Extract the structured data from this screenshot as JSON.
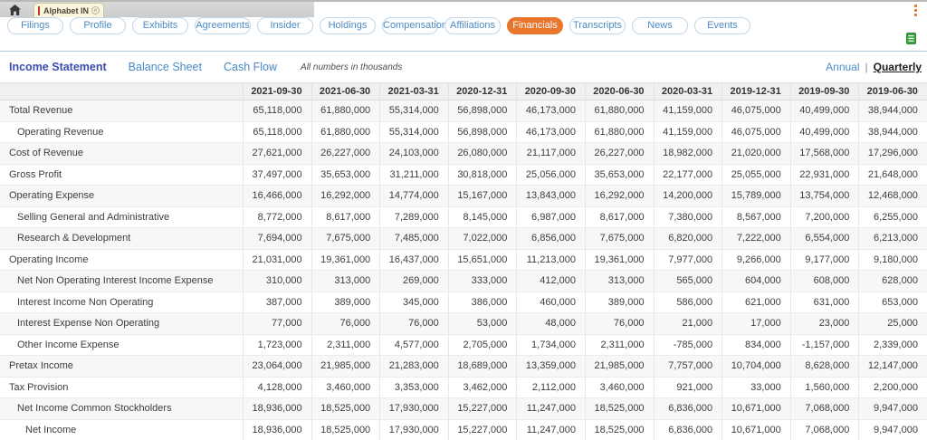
{
  "window": {
    "tab_title": "Alphabet INC",
    "tab_close_glyph": "×"
  },
  "icons": {
    "home": "home-icon",
    "tab_close": "close-icon",
    "menu": "kebab-menu-icon",
    "export": "spreadsheet-export-icon"
  },
  "colors": {
    "accent_orange": "#e8762c",
    "link_blue": "#4a8bc9",
    "active_statement_blue": "#3a4db0",
    "export_green": "#3aa33f",
    "tab_accent_red": "#b6392e",
    "header_gray": "#f0f0f0",
    "stripe_gray": "#f7f7f7"
  },
  "nav_pills": [
    {
      "label": "Filings",
      "active": false
    },
    {
      "label": "Profile",
      "active": false
    },
    {
      "label": "Exhibits",
      "active": false
    },
    {
      "label": "Agreements",
      "active": false
    },
    {
      "label": "Insider",
      "active": false
    },
    {
      "label": "Holdings",
      "active": false
    },
    {
      "label": "Compensation",
      "active": false
    },
    {
      "label": "Affiliations",
      "active": false
    },
    {
      "label": "Financials",
      "active": true
    },
    {
      "label": "Transcripts",
      "active": false
    },
    {
      "label": "News",
      "active": false
    },
    {
      "label": "Events",
      "active": false
    }
  ],
  "statement_nav": {
    "tabs": [
      {
        "label": "Income Statement",
        "active": true
      },
      {
        "label": "Balance Sheet",
        "active": false
      },
      {
        "label": "Cash Flow",
        "active": false
      }
    ],
    "note": "All numbers in thousands",
    "separator": "|",
    "period_options": [
      {
        "label": "Annual",
        "active": false
      },
      {
        "label": "Quarterly",
        "active": true
      }
    ]
  },
  "chart_data": {
    "type": "table",
    "title": "Income Statement (Quarterly)",
    "columns": [
      "2021-09-30",
      "2021-06-30",
      "2021-03-31",
      "2020-12-31",
      "2020-09-30",
      "2020-06-30",
      "2020-03-31",
      "2019-12-31",
      "2019-09-30",
      "2019-06-30"
    ],
    "rows": [
      {
        "label": "Total Revenue",
        "indent": 0,
        "values": [
          "65,118,000",
          "61,880,000",
          "55,314,000",
          "56,898,000",
          "46,173,000",
          "61,880,000",
          "41,159,000",
          "46,075,000",
          "40,499,000",
          "38,944,000"
        ]
      },
      {
        "label": "Operating Revenue",
        "indent": 1,
        "values": [
          "65,118,000",
          "61,880,000",
          "55,314,000",
          "56,898,000",
          "46,173,000",
          "61,880,000",
          "41,159,000",
          "46,075,000",
          "40,499,000",
          "38,944,000"
        ]
      },
      {
        "label": "Cost of Revenue",
        "indent": 0,
        "values": [
          "27,621,000",
          "26,227,000",
          "24,103,000",
          "26,080,000",
          "21,117,000",
          "26,227,000",
          "18,982,000",
          "21,020,000",
          "17,568,000",
          "17,296,000"
        ]
      },
      {
        "label": "Gross Profit",
        "indent": 0,
        "values": [
          "37,497,000",
          "35,653,000",
          "31,211,000",
          "30,818,000",
          "25,056,000",
          "35,653,000",
          "22,177,000",
          "25,055,000",
          "22,931,000",
          "21,648,000"
        ]
      },
      {
        "label": "Operating Expense",
        "indent": 0,
        "values": [
          "16,466,000",
          "16,292,000",
          "14,774,000",
          "15,167,000",
          "13,843,000",
          "16,292,000",
          "14,200,000",
          "15,789,000",
          "13,754,000",
          "12,468,000"
        ]
      },
      {
        "label": "Selling General and Administrative",
        "indent": 1,
        "values": [
          "8,772,000",
          "8,617,000",
          "7,289,000",
          "8,145,000",
          "6,987,000",
          "8,617,000",
          "7,380,000",
          "8,567,000",
          "7,200,000",
          "6,255,000"
        ]
      },
      {
        "label": "Research & Development",
        "indent": 1,
        "values": [
          "7,694,000",
          "7,675,000",
          "7,485,000",
          "7,022,000",
          "6,856,000",
          "7,675,000",
          "6,820,000",
          "7,222,000",
          "6,554,000",
          "6,213,000"
        ]
      },
      {
        "label": "Operating Income",
        "indent": 0,
        "values": [
          "21,031,000",
          "19,361,000",
          "16,437,000",
          "15,651,000",
          "11,213,000",
          "19,361,000",
          "7,977,000",
          "9,266,000",
          "9,177,000",
          "9,180,000"
        ]
      },
      {
        "label": "Net Non Operating Interest Income Expense",
        "indent": 1,
        "values": [
          "310,000",
          "313,000",
          "269,000",
          "333,000",
          "412,000",
          "313,000",
          "565,000",
          "604,000",
          "608,000",
          "628,000"
        ]
      },
      {
        "label": "Interest Income Non Operating",
        "indent": 1,
        "values": [
          "387,000",
          "389,000",
          "345,000",
          "386,000",
          "460,000",
          "389,000",
          "586,000",
          "621,000",
          "631,000",
          "653,000"
        ]
      },
      {
        "label": "Interest Expense Non Operating",
        "indent": 1,
        "values": [
          "77,000",
          "76,000",
          "76,000",
          "53,000",
          "48,000",
          "76,000",
          "21,000",
          "17,000",
          "23,000",
          "25,000"
        ]
      },
      {
        "label": "Other Income Expense",
        "indent": 1,
        "values": [
          "1,723,000",
          "2,311,000",
          "4,577,000",
          "2,705,000",
          "1,734,000",
          "2,311,000",
          "-785,000",
          "834,000",
          "-1,157,000",
          "2,339,000"
        ]
      },
      {
        "label": "Pretax Income",
        "indent": 0,
        "values": [
          "23,064,000",
          "21,985,000",
          "21,283,000",
          "18,689,000",
          "13,359,000",
          "21,985,000",
          "7,757,000",
          "10,704,000",
          "8,628,000",
          "12,147,000"
        ]
      },
      {
        "label": "Tax Provision",
        "indent": 0,
        "values": [
          "4,128,000",
          "3,460,000",
          "3,353,000",
          "3,462,000",
          "2,112,000",
          "3,460,000",
          "921,000",
          "33,000",
          "1,560,000",
          "2,200,000"
        ]
      },
      {
        "label": "Net Income Common Stockholders",
        "indent": 1,
        "values": [
          "18,936,000",
          "18,525,000",
          "17,930,000",
          "15,227,000",
          "11,247,000",
          "18,525,000",
          "6,836,000",
          "10,671,000",
          "7,068,000",
          "9,947,000"
        ]
      },
      {
        "label": "Net Income",
        "indent": 2,
        "values": [
          "18,936,000",
          "18,525,000",
          "17,930,000",
          "15,227,000",
          "11,247,000",
          "18,525,000",
          "6,836,000",
          "10,671,000",
          "7,068,000",
          "9,947,000"
        ]
      }
    ]
  }
}
